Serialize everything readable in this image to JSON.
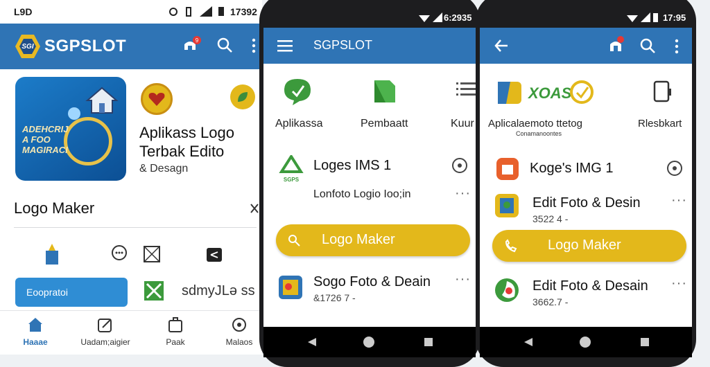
{
  "left": {
    "status": {
      "time": "L9D",
      "right": "17392"
    },
    "appbar": {
      "brand": "SGPSLOT",
      "logo_text": "SGI",
      "notification_count": "9"
    },
    "banner": {
      "text_line1": "ADEHCRIJ",
      "text_line2": "A  FOO",
      "text_line3": "MAGIRACI"
    },
    "app_title_line1": "Aplikass Logo",
    "app_title_line2": "Terbak Edito",
    "app_subtitle": "& Desagn",
    "section_title": "Logo Maker",
    "explore_button": "Eoopratoi",
    "side_text": "sdmyJLə ss",
    "bottom_nav": [
      {
        "label": "Haaae"
      },
      {
        "label": "Uadam;aigier"
      },
      {
        "label": "Paak"
      },
      {
        "label": "Malaos"
      }
    ]
  },
  "middle": {
    "status": {
      "time": "6:2935"
    },
    "appbar": {
      "title": "SGPSLOT"
    },
    "categories": [
      {
        "label": "Aplikassa"
      },
      {
        "label": "Pembaatt"
      },
      {
        "label": "Kuur"
      }
    ],
    "row1": {
      "title": "Loges IMS 1",
      "subtitle": "Lonfoto Logio Ioo;in",
      "icon_text": "SGPS"
    },
    "cta": "Logo Maker",
    "row2": {
      "title": "Sogo Foto & Deain",
      "meta": "&1726 7 -"
    }
  },
  "right": {
    "status": {
      "time": "17:95"
    },
    "categories": [
      {
        "label": "Aplicalaemoto ttetog",
        "sub": "Conamanoontes"
      },
      {
        "label": "Rlesbkart"
      }
    ],
    "brand_mark": "XOAS",
    "row1": {
      "title": "Koge's IMG 1"
    },
    "row2": {
      "title": "Edit Foto & Desin",
      "meta": "3522 4 -"
    },
    "cta": "Logo Maker",
    "row3": {
      "title": "Edit Foto & Desain",
      "meta": "3662.7 -"
    }
  },
  "colors": {
    "primary": "#2f74b5",
    "accent": "#e3b81b",
    "danger": "#e53935"
  }
}
